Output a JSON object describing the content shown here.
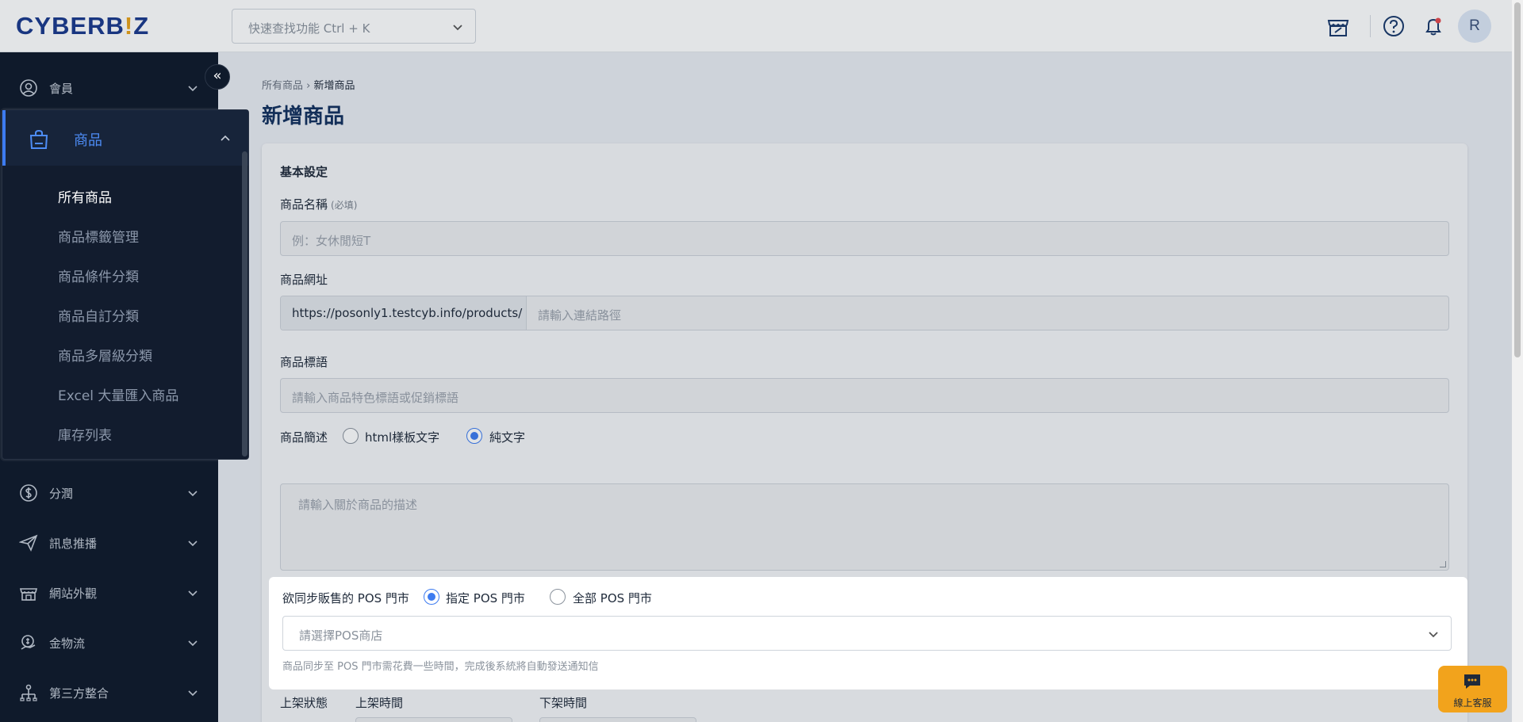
{
  "brand": {
    "logo_main": "CYBERB",
    "logo_dot": "!",
    "logo_end": "Z"
  },
  "search": {
    "placeholder": "快速查找功能 Ctrl + K"
  },
  "user": {
    "avatar_initial": "R"
  },
  "sidebar": {
    "items": [
      {
        "label": "會員",
        "icon": "user-circle-icon"
      },
      {
        "label": "分潤",
        "icon": "dollar-icon"
      },
      {
        "label": "訊息推播",
        "icon": "send-icon"
      },
      {
        "label": "網站外觀",
        "icon": "storefront-icon"
      },
      {
        "label": "金物流",
        "icon": "payment-icon"
      },
      {
        "label": "第三方整合",
        "icon": "integration-icon"
      }
    ],
    "expanded": {
      "label": "商品",
      "icon": "shopping-bag-icon",
      "children": [
        "所有商品",
        "商品標籤管理",
        "商品條件分類",
        "商品自訂分類",
        "商品多層級分類",
        "Excel 大量匯入商品",
        "庫存列表"
      ]
    },
    "collapse_glyph": "«"
  },
  "breadcrumb": {
    "parent": "所有商品",
    "separator": "›",
    "current": "新增商品"
  },
  "page": {
    "title": "新增商品"
  },
  "form": {
    "section_title": "基本設定",
    "name": {
      "label": "商品名稱",
      "required": "(必填)",
      "placeholder": "例：女休閒短T"
    },
    "url": {
      "label": "商品網址",
      "prefix": "https://posonly1.testcyb.info/products/",
      "placeholder": "請輸入連結路徑"
    },
    "slogan": {
      "label": "商品標語",
      "placeholder": "請輸入商品特色標語或促銷標語"
    },
    "description": {
      "label": "商品簡述",
      "option_html": "html樣板文字",
      "option_plain": "純文字",
      "selected": "純文字",
      "placeholder": "請輸入關於商品的描述"
    },
    "pos": {
      "label": "欲同步販售的 POS 門市",
      "option_specific": "指定 POS 門市",
      "option_all": "全部 POS 門市",
      "selected": "指定 POS 門市",
      "placeholder": "請選擇POS商店",
      "hint": "商品同步至 POS 門市需花費一些時間，完成後系統將自動發送通知信"
    },
    "bottom": {
      "status_label": "上架狀態",
      "publish_label": "上架時間",
      "unpublish_label": "下架時間"
    }
  },
  "support": {
    "label": "線上客服"
  },
  "colors": {
    "accent": "#3d7bf0",
    "sidebar_bg": "#0f1a2b",
    "title": "#13305e",
    "support": "#f2a31c"
  }
}
